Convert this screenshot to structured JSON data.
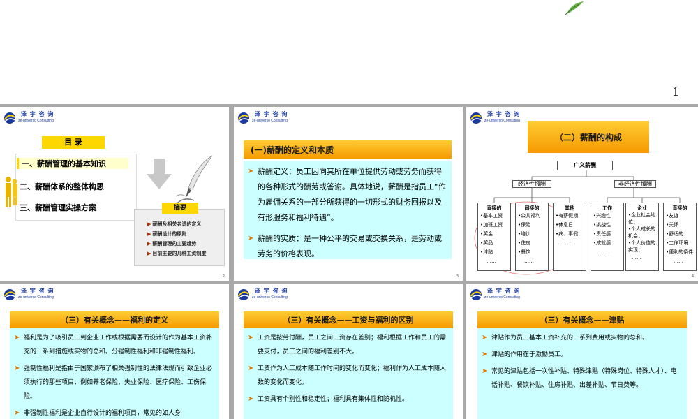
{
  "page_number": "1",
  "logo": {
    "cn": "泽 宇 咨 询",
    "en": "ze-universo Consulting"
  },
  "slides": {
    "s2": {
      "toc_header": "目 录",
      "toc_items": [
        "一、薪酬管理的基本知识",
        "二、薪酬体系的整体构思",
        "三、薪酬管理实操方案"
      ],
      "summary_title": "摘要",
      "summary_items": [
        "薪酬及相关名词的定义",
        "薪酬设计的原则",
        "薪酬管理的主要趋势",
        "目前主要的几种工资制度"
      ],
      "slide_no": "2"
    },
    "s3": {
      "title": "(一)薪酬的定义和本质",
      "bullets": [
        "薪酬定义：员工因向其所在单位提供劳动或劳务而获得的各种形式的酬劳或答谢。具体地说，薪酬是指员工“作为雇佣关系的一部分所获得的一切形式的财务回报以及有形服务和福利待遇”。",
        "薪酬的实质：是一种公平的交易或交换关系，是劳动或劳务的价格表现。"
      ],
      "slide_no": "3"
    },
    "s4": {
      "title": "（二）薪酬的构成",
      "root": "广义薪酬",
      "econ": "经济性报酬",
      "nonecon": "非经济性报酬",
      "cols": [
        {
          "head": "直接的",
          "items": [
            "•基本工资",
            "•加班工资",
            "•奖金",
            "•奖品",
            "•津贴",
            "……"
          ]
        },
        {
          "head": "间接的",
          "items": [
            "•公共福利",
            "•保险",
            "•培训",
            "•住房",
            "•餐饮",
            "……"
          ]
        },
        {
          "head": "其他",
          "items": [
            "•有薪假期",
            "•休息日",
            "•病、事假",
            "……"
          ]
        },
        {
          "head": "工作",
          "items": [
            "•兴趣性",
            "•挑战性",
            "•责任感",
            "•成就感",
            "……"
          ]
        },
        {
          "head": "企业",
          "items": [
            "•企业社会地位；",
            "•个人成长的机会；",
            "•个人价值的实现；",
            "……"
          ]
        },
        {
          "head": "直接的",
          "items": [
            "•友谊",
            "•关怀",
            "•舒适的",
            "•工作环境",
            "•便利的条件",
            "……"
          ]
        }
      ],
      "slide_no": "4"
    },
    "s5": {
      "title": "（三）有关概念——福利的定义",
      "bullets": [
        "福利是为了吸引员工到企业工作或根据需要而设计的作为基本工资补充的一系列措施或实物的总和。分强制性福利和非强制性福利。",
        "强制性福利是指由于国家颁布了相关强制性的法律法规而引致企业必须执行的那些项目，例如养老保险、失业保险、医疗保险、工伤保险。",
        "非强制性福利是企业自行设计的福利项目，常见的如人身"
      ]
    },
    "s6": {
      "title": "（三）有关概念——工资与福利的区别",
      "bullets": [
        "工资是按劳付酬，员工之间工资存在差别；福利根据工作和员工的需要支付，员工之间的福利差别不大。",
        "工资作为人工成本随工作时间的变化而变化；福利作为人工成本随人数的变化而变化。",
        "工资具有个别性和稳定性；福利具有集体性和随机性。"
      ]
    },
    "s7": {
      "title": "（三）有关概念——津贴",
      "bullets": [
        "津贴作为员工基本工资补充的一系列费用或实物的总和。",
        "津贴的作用在于激励员工。",
        "常见的津贴包括一次性补贴、特殊津贴（特殊岗位、特殊人才）、电话补贴、餐饮补贴、住房补贴、出差补贴、节日费等。"
      ]
    }
  }
}
